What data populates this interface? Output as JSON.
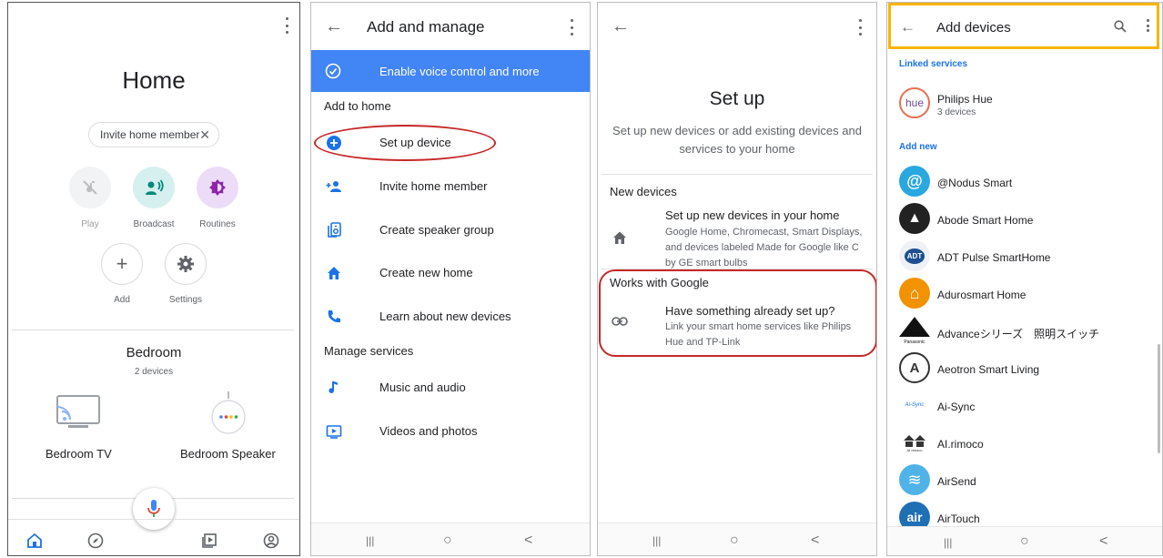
{
  "screen1": {
    "title": "Home",
    "chip_label": "Invite home member",
    "chip_close": "✕",
    "actions": [
      {
        "label": "Play",
        "icon": "music-off-icon"
      },
      {
        "label": "Broadcast",
        "icon": "broadcast-icon"
      },
      {
        "label": "Routines",
        "icon": "routines-icon"
      }
    ],
    "add_label": "Add",
    "add_glyph": "+",
    "settings_label": "Settings",
    "room": {
      "title": "Bedroom",
      "subtitle": "2 devices"
    },
    "devices": [
      {
        "label": "Bedroom TV",
        "icon": "tv-icon"
      },
      {
        "label": "Bedroom Speaker",
        "icon": "speaker-icon"
      }
    ],
    "nav": [
      "home-icon",
      "explore-icon",
      "media-icon",
      "account-icon"
    ]
  },
  "screen2": {
    "back_glyph": "←",
    "title": "Add and manage",
    "banner": "Enable voice control and more",
    "section_add": "Add to home",
    "items_add": [
      {
        "label": "Set up device",
        "icon": "add-circle-icon"
      },
      {
        "label": "Invite home member",
        "icon": "person-add-icon"
      },
      {
        "label": "Create speaker group",
        "icon": "speaker-group-icon"
      },
      {
        "label": "Create new home",
        "icon": "house-icon"
      },
      {
        "label": "Learn about new devices",
        "icon": "phone-icon"
      }
    ],
    "section_manage": "Manage services",
    "items_manage": [
      {
        "label": "Music and audio",
        "icon": "music-note-icon"
      },
      {
        "label": "Videos and photos",
        "icon": "video-icon"
      }
    ],
    "nav": {
      "recent": "|||",
      "home": "○",
      "back": "<"
    }
  },
  "screen3": {
    "back_glyph": "←",
    "title": "Set up",
    "description": "Set up new devices or add existing devices and services to your home",
    "new_devices": {
      "header": "New devices",
      "title": "Set up new devices in your home",
      "description": "Google Home, Chromecast, Smart Displays, and devices labeled Made for Google like C by GE smart bulbs"
    },
    "works_with": {
      "header": "Works with Google",
      "title": "Have something already set up?",
      "description": "Link your smart home services like Philips Hue and TP-Link"
    },
    "nav": {
      "recent": "|||",
      "home": "○",
      "back": "<"
    }
  },
  "screen4": {
    "back_glyph": "←",
    "title": "Add devices",
    "linked_header": "Linked services",
    "linked": [
      {
        "name": "Philips Hue",
        "sub": "3 devices",
        "logo_text": "hue"
      }
    ],
    "add_new_header": "Add new",
    "services": [
      {
        "name": "@Nodus Smart",
        "logo_text": "@",
        "color": "#29a8e0"
      },
      {
        "name": "Abode Smart Home",
        "logo_text": "▲",
        "color": "#222222"
      },
      {
        "name": "ADT Pulse SmartHome",
        "logo_text": "ADT",
        "color": "#1d4f91"
      },
      {
        "name": "Adurosmart Home",
        "logo_text": "⌂",
        "color": "#f39200"
      },
      {
        "name": "Advanceシリーズ　照明スイッチ",
        "logo_text": "Panasonic",
        "color": "#111111"
      },
      {
        "name": "Aeotron Smart Living",
        "logo_text": "A",
        "color": "#ffffff"
      },
      {
        "name": "Ai-Sync",
        "logo_text": "Ai-Sync",
        "color": "#ffffff"
      },
      {
        "name": "AI.rimoco",
        "logo_text": "AI.rimoco",
        "color": "#ffffff"
      },
      {
        "name": "AirSend",
        "logo_text": "≋",
        "color": "#4fb3e8"
      },
      {
        "name": "AirTouch",
        "logo_text": "air",
        "color": "#1f6fb5"
      }
    ],
    "nav": {
      "recent": "|||",
      "home": "○",
      "back": "<"
    }
  }
}
